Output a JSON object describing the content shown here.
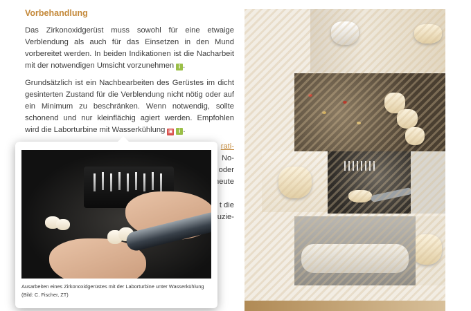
{
  "section": {
    "heading": "Vorbehandlung",
    "para1": "Das Zirkonoxidgerüst muss sowohl für eine etwaige Verblendung als auch für das Einsetzen in den Mund vorbereitet werden. In beiden Indikationen ist die Nacharbeit mit der notwendigen Umsicht vorzunehmen",
    "para2": "Grundsätzlich ist ein Nachbearbeiten des Gerüstes im dicht gesinterten Zustand für die Verblendung nicht nötig oder auf ein Minimum zu beschränken. Wenn notwendig, sollte schonend und nur kleinflächig agiert werden. Empfohlen wird die Laborturbine mit Wasserkühlung",
    "icon_info": "i",
    "icon_photo": "photo-icon"
  },
  "obscured_text": {
    "line1_link": "rati-",
    "line2": "No-",
    "line3": "oder",
    "line4": "heute",
    "line5": "t die",
    "line6": "uzie-"
  },
  "popup": {
    "caption": "Ausarbeiten eines Zirkonoxidgerüstes mit der Laborturbine unter Wasserkühlung (Bild: C. Fischer, ZT)"
  },
  "colors": {
    "heading": "#c4893a",
    "info_icon": "#9bbf48",
    "photo_icon": "#d9534f"
  }
}
